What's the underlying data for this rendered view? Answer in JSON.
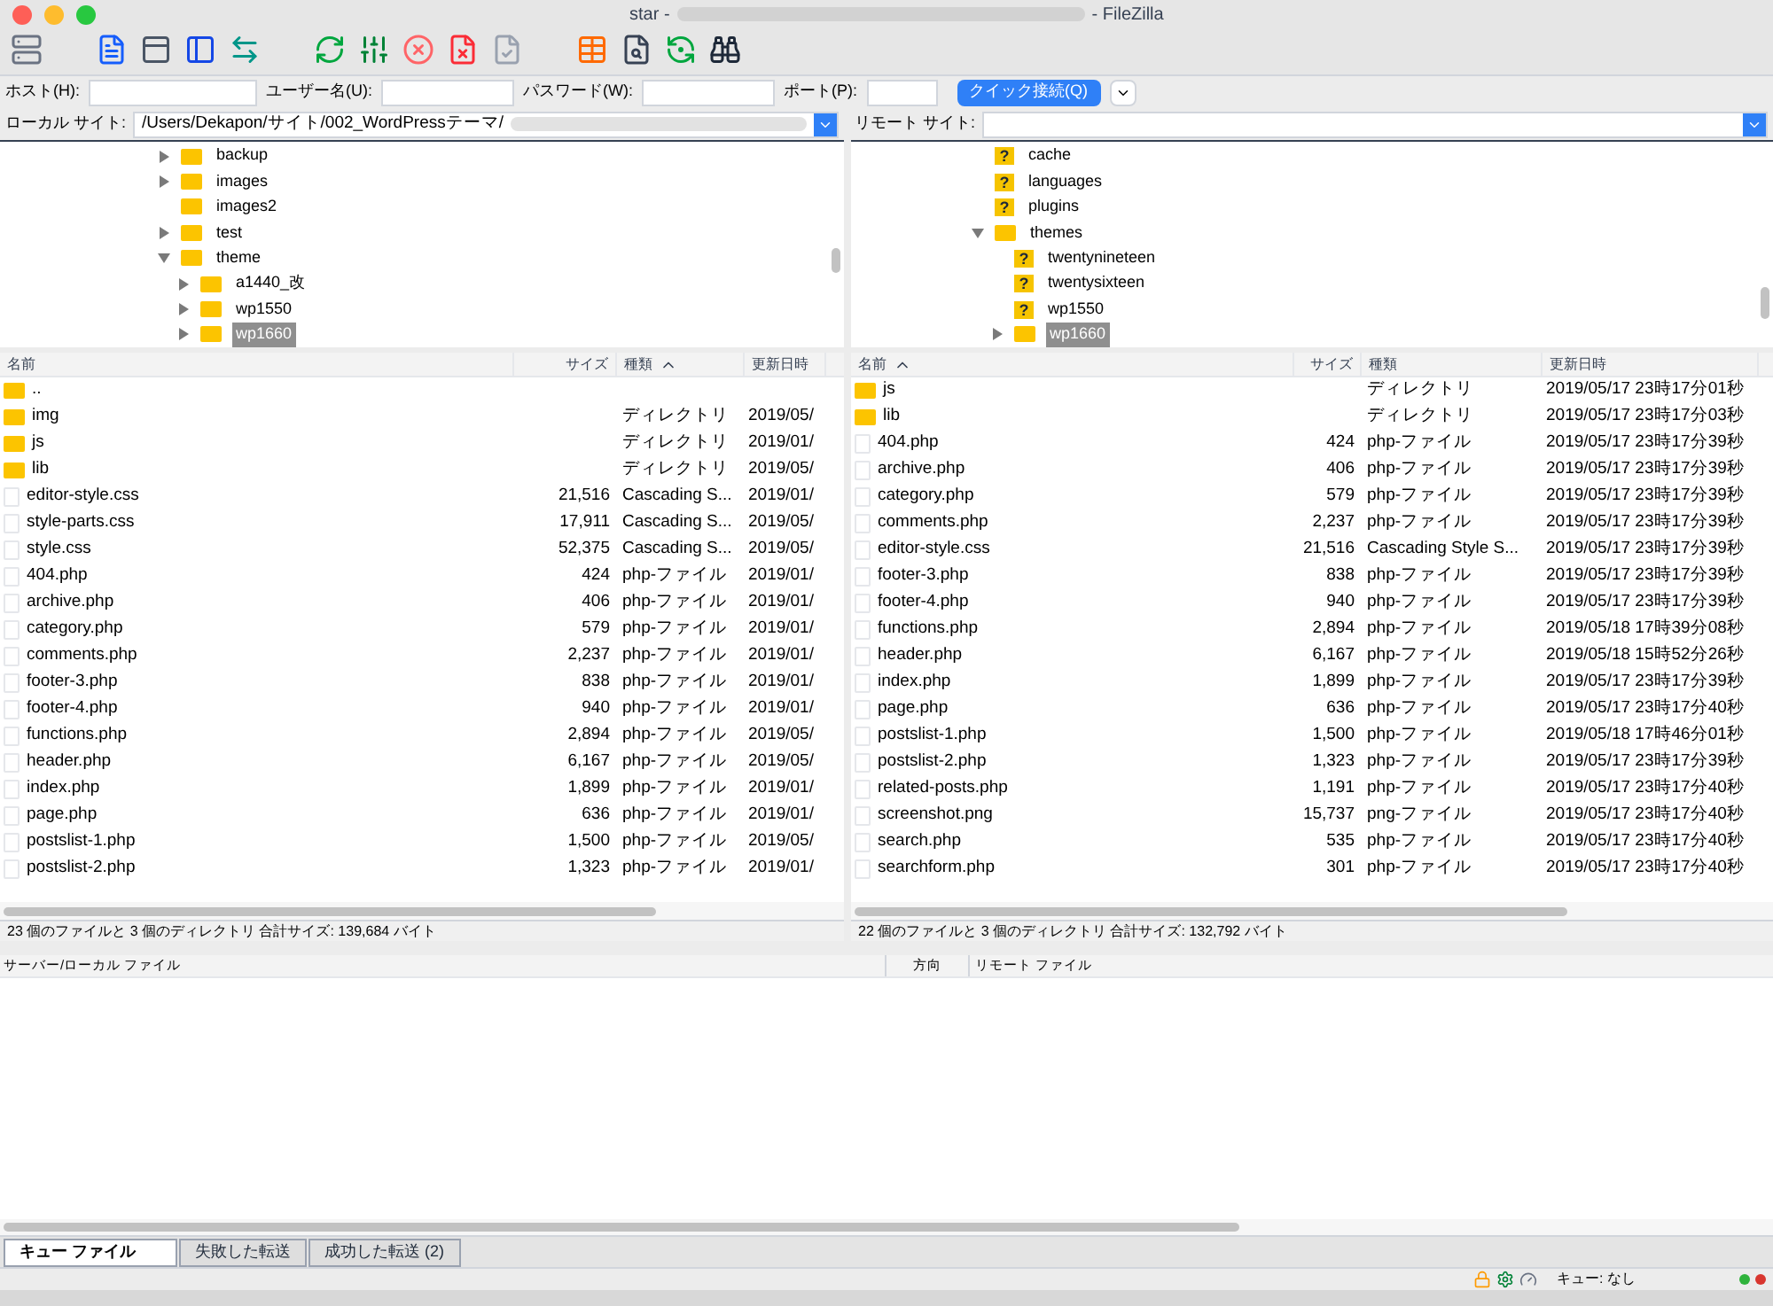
{
  "window": {
    "title_start": "star -",
    "title_end": "- FileZilla"
  },
  "toolbar": [
    {
      "kind": "server"
    },
    {
      "kind": "log"
    },
    {
      "kind": "tree-local"
    },
    {
      "kind": "tree-remote"
    },
    {
      "kind": "queue"
    },
    {
      "kind": "refresh"
    },
    {
      "kind": "filter"
    },
    {
      "kind": "cancel"
    },
    {
      "kind": "disconnect"
    },
    {
      "kind": "reconnect"
    },
    {
      "kind": "list"
    },
    {
      "kind": "search"
    },
    {
      "kind": "compare"
    },
    {
      "kind": "find"
    }
  ],
  "quickconnect": {
    "host_label": "ホスト(H):",
    "user_label": "ユーザー名(U):",
    "password_label": "パスワード(W):",
    "port_label": "ポート(P):",
    "button": "クイック接続(Q)"
  },
  "local": {
    "site_label": "ローカル サイト:",
    "path": "/Users/Dekapon/サイト/002_WordPressテーマ/",
    "tree": [
      {
        "name": "backup",
        "kind": "folder",
        "expandable": true,
        "expanded": false,
        "selected": false
      },
      {
        "name": "images",
        "kind": "folder",
        "expandable": true,
        "expanded": false,
        "selected": false
      },
      {
        "name": "images2",
        "kind": "folder",
        "expandable": false,
        "selected": false
      },
      {
        "name": "test",
        "kind": "folder",
        "expandable": true,
        "expanded": false,
        "selected": false
      },
      {
        "name": "theme",
        "kind": "folder",
        "expandable": true,
        "expanded": true,
        "selected": false,
        "children": [
          {
            "name": "a1440_改",
            "kind": "folder",
            "expandable": true,
            "expanded": false,
            "selected": false
          },
          {
            "name": "wp1550",
            "kind": "folder",
            "expandable": true,
            "expanded": false,
            "selected": false
          },
          {
            "name": "wp1660",
            "kind": "folder",
            "expandable": true,
            "expanded": false,
            "selected": true
          }
        ]
      }
    ],
    "columns": [
      {
        "label": "名前",
        "sorted": false
      },
      {
        "label": "サイズ",
        "sorted": false
      },
      {
        "label": "種類",
        "sorted": true
      },
      {
        "label": "更新日時",
        "sorted": false
      }
    ],
    "files": [
      {
        "name": "..",
        "kind": "folder"
      },
      {
        "name": "img",
        "kind": "folder",
        "type": "ディレクトリ",
        "modified": "2019/05/"
      },
      {
        "name": "js",
        "kind": "folder",
        "type": "ディレクトリ",
        "modified": "2019/01/"
      },
      {
        "name": "lib",
        "kind": "folder",
        "type": "ディレクトリ",
        "modified": "2019/05/"
      },
      {
        "name": "editor-style.css",
        "kind": "file",
        "size": "21,516",
        "type": "Cascading S...",
        "modified": "2019/01/"
      },
      {
        "name": "style-parts.css",
        "kind": "file",
        "size": "17,911",
        "type": "Cascading S...",
        "modified": "2019/05/"
      },
      {
        "name": "style.css",
        "kind": "file",
        "size": "52,375",
        "type": "Cascading S...",
        "modified": "2019/05/"
      },
      {
        "name": "404.php",
        "kind": "file",
        "size": "424",
        "type": "php-ファイル",
        "modified": "2019/01/"
      },
      {
        "name": "archive.php",
        "kind": "file",
        "size": "406",
        "type": "php-ファイル",
        "modified": "2019/01/"
      },
      {
        "name": "category.php",
        "kind": "file",
        "size": "579",
        "type": "php-ファイル",
        "modified": "2019/01/"
      },
      {
        "name": "comments.php",
        "kind": "file",
        "size": "2,237",
        "type": "php-ファイル",
        "modified": "2019/01/"
      },
      {
        "name": "footer-3.php",
        "kind": "file",
        "size": "838",
        "type": "php-ファイル",
        "modified": "2019/01/"
      },
      {
        "name": "footer-4.php",
        "kind": "file",
        "size": "940",
        "type": "php-ファイル",
        "modified": "2019/01/"
      },
      {
        "name": "functions.php",
        "kind": "file",
        "size": "2,894",
        "type": "php-ファイル",
        "modified": "2019/05/"
      },
      {
        "name": "header.php",
        "kind": "file",
        "size": "6,167",
        "type": "php-ファイル",
        "modified": "2019/05/"
      },
      {
        "name": "index.php",
        "kind": "file",
        "size": "1,899",
        "type": "php-ファイル",
        "modified": "2019/01/"
      },
      {
        "name": "page.php",
        "kind": "file",
        "size": "636",
        "type": "php-ファイル",
        "modified": "2019/01/"
      },
      {
        "name": "postslist-1.php",
        "kind": "file",
        "size": "1,500",
        "type": "php-ファイル",
        "modified": "2019/05/"
      },
      {
        "name": "postslist-2.php",
        "kind": "file",
        "size": "1,323",
        "type": "php-ファイル",
        "modified": "2019/01/"
      }
    ],
    "status": "23 個のファイルと 3 個のディレクトリ 合計サイズ: 139,684 バイト"
  },
  "remote": {
    "site_label": "リモート サイト:",
    "tree": [
      {
        "name": "cache",
        "kind": "unknown",
        "icon_char": "?",
        "expandable": false,
        "selected": false
      },
      {
        "name": "languages",
        "kind": "unknown",
        "icon_char": "?",
        "expandable": false,
        "selected": false
      },
      {
        "name": "plugins",
        "kind": "unknown",
        "icon_char": "?",
        "expandable": false,
        "selected": false
      },
      {
        "name": "themes",
        "kind": "folder",
        "expandable": true,
        "expanded": true,
        "selected": false,
        "children": [
          {
            "name": "twentynineteen",
            "kind": "unknown",
            "icon_char": "?",
            "expandable": false,
            "selected": false
          },
          {
            "name": "twentysixteen",
            "kind": "unknown",
            "icon_char": "?",
            "expandable": false,
            "selected": false
          },
          {
            "name": "wp1550",
            "kind": "unknown",
            "icon_char": "?",
            "expandable": false,
            "selected": false
          },
          {
            "name": "wp1660",
            "kind": "folder",
            "expandable": true,
            "expanded": false,
            "selected": true
          }
        ]
      }
    ],
    "columns": [
      {
        "label": "名前",
        "sorted": true
      },
      {
        "label": "サイズ",
        "sorted": false
      },
      {
        "label": "種類",
        "sorted": false
      },
      {
        "label": "更新日時",
        "sorted": false
      }
    ],
    "files": [
      {
        "name": "js",
        "kind": "folder",
        "type": "ディレクトリ",
        "modified": "2019/05/17 23時17分01秒"
      },
      {
        "name": "lib",
        "kind": "folder",
        "type": "ディレクトリ",
        "modified": "2019/05/17 23時17分03秒"
      },
      {
        "name": "404.php",
        "kind": "file",
        "size": "424",
        "type": "php-ファイル",
        "modified": "2019/05/17 23時17分39秒"
      },
      {
        "name": "archive.php",
        "kind": "file",
        "size": "406",
        "type": "php-ファイル",
        "modified": "2019/05/17 23時17分39秒"
      },
      {
        "name": "category.php",
        "kind": "file",
        "size": "579",
        "type": "php-ファイル",
        "modified": "2019/05/17 23時17分39秒"
      },
      {
        "name": "comments.php",
        "kind": "file",
        "size": "2,237",
        "type": "php-ファイル",
        "modified": "2019/05/17 23時17分39秒"
      },
      {
        "name": "editor-style.css",
        "kind": "file",
        "size": "21,516",
        "type": "Cascading Style S...",
        "modified": "2019/05/17 23時17分39秒"
      },
      {
        "name": "footer-3.php",
        "kind": "file",
        "size": "838",
        "type": "php-ファイル",
        "modified": "2019/05/17 23時17分39秒"
      },
      {
        "name": "footer-4.php",
        "kind": "file",
        "size": "940",
        "type": "php-ファイル",
        "modified": "2019/05/17 23時17分39秒"
      },
      {
        "name": "functions.php",
        "kind": "file",
        "size": "2,894",
        "type": "php-ファイル",
        "modified": "2019/05/18 17時39分08秒"
      },
      {
        "name": "header.php",
        "kind": "file",
        "size": "6,167",
        "type": "php-ファイル",
        "modified": "2019/05/18 15時52分26秒"
      },
      {
        "name": "index.php",
        "kind": "file",
        "size": "1,899",
        "type": "php-ファイル",
        "modified": "2019/05/17 23時17分39秒"
      },
      {
        "name": "page.php",
        "kind": "file",
        "size": "636",
        "type": "php-ファイル",
        "modified": "2019/05/17 23時17分40秒"
      },
      {
        "name": "postslist-1.php",
        "kind": "file",
        "size": "1,500",
        "type": "php-ファイル",
        "modified": "2019/05/18 17時46分01秒"
      },
      {
        "name": "postslist-2.php",
        "kind": "file",
        "size": "1,323",
        "type": "php-ファイル",
        "modified": "2019/05/17 23時17分39秒"
      },
      {
        "name": "related-posts.php",
        "kind": "file",
        "size": "1,191",
        "type": "php-ファイル",
        "modified": "2019/05/17 23時17分40秒"
      },
      {
        "name": "screenshot.png",
        "kind": "file",
        "size": "15,737",
        "type": "png-ファイル",
        "modified": "2019/05/17 23時17分40秒"
      },
      {
        "name": "search.php",
        "kind": "file",
        "size": "535",
        "type": "php-ファイル",
        "modified": "2019/05/17 23時17分40秒"
      },
      {
        "name": "searchform.php",
        "kind": "file",
        "size": "301",
        "type": "php-ファイル",
        "modified": "2019/05/17 23時17分40秒"
      }
    ],
    "status": "22 個のファイルと 3 個のディレクトリ 合計サイズ: 132,792 バイト"
  },
  "queue": {
    "columns": [
      "サーバー/ローカル ファイル",
      "方向",
      "リモート ファイル"
    ],
    "tabs": [
      {
        "label": "キュー ファイル",
        "selected": true
      },
      {
        "label": "失敗した転送",
        "selected": false
      },
      {
        "label": "成功した転送 (2)",
        "selected": false
      }
    ]
  },
  "status_bar": {
    "queue": "キュー: なし",
    "lights": [
      {
        "color": "#2fb33c"
      },
      {
        "color": "#d8362f"
      }
    ]
  }
}
